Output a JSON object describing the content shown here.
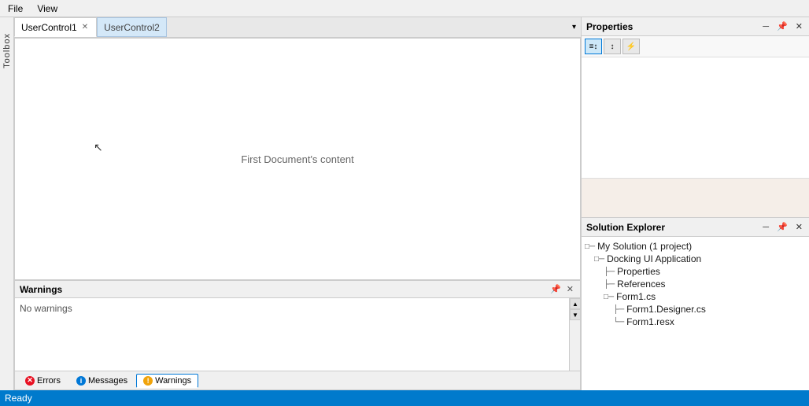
{
  "menu": {
    "file_label": "File",
    "view_label": "View"
  },
  "toolbox": {
    "label": "Toolbox"
  },
  "tabs": [
    {
      "label": "UserControl1",
      "active": true,
      "closeable": true
    },
    {
      "label": "UserControl2",
      "active": false,
      "closeable": false
    }
  ],
  "tab_dropdown_arrow": "▾",
  "document": {
    "content": "First Document's content"
  },
  "warnings_panel": {
    "title": "Warnings",
    "no_warnings": "No warnings",
    "pin_btn": "📌",
    "close_btn": "✕"
  },
  "bottom_tabs": [
    {
      "label": "Errors",
      "icon_type": "error",
      "icon_symbol": "✕",
      "active": false
    },
    {
      "label": "Messages",
      "icon_type": "message",
      "icon_symbol": "i",
      "active": false
    },
    {
      "label": "Warnings",
      "icon_type": "warning",
      "icon_symbol": "!",
      "active": true
    }
  ],
  "properties": {
    "title": "Properties",
    "btn_categorized": "≡",
    "btn_sorted": "↕",
    "btn_events": "⚡"
  },
  "solution_explorer": {
    "title": "Solution Explorer",
    "tree": [
      {
        "indent": 0,
        "prefix": "□─",
        "text": "My Solution (1 project)"
      },
      {
        "indent": 1,
        "prefix": "□─",
        "text": "Docking UI Application"
      },
      {
        "indent": 2,
        "prefix": "├─",
        "text": "Properties"
      },
      {
        "indent": 2,
        "prefix": "├─",
        "text": "References"
      },
      {
        "indent": 2,
        "prefix": "□─",
        "text": "Form1.cs"
      },
      {
        "indent": 3,
        "prefix": "├─",
        "text": "Form1.Designer.cs"
      },
      {
        "indent": 3,
        "prefix": "└─",
        "text": "Form1.resx"
      }
    ]
  },
  "status_bar": {
    "text": "Ready"
  }
}
